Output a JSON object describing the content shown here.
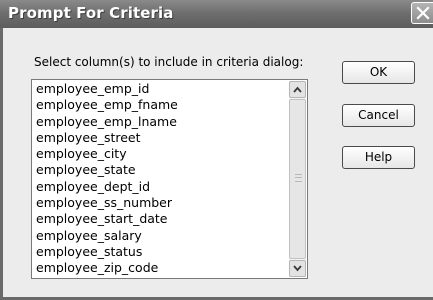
{
  "window": {
    "title": "Prompt For Criteria"
  },
  "dialog": {
    "instruction": "Select column(s) to include in criteria dialog:",
    "columns": [
      "employee_emp_id",
      "employee_emp_fname",
      "employee_emp_lname",
      "employee_street",
      "employee_city",
      "employee_state",
      "employee_dept_id",
      "employee_ss_number",
      "employee_start_date",
      "employee_salary",
      "employee_status",
      "employee_zip_code"
    ]
  },
  "buttons": {
    "ok": "OK",
    "cancel": "Cancel",
    "help": "Help"
  },
  "icons": {
    "close": "close-icon",
    "scroll_up": "scroll-up-arrow-icon",
    "scroll_down": "scroll-down-arrow-icon"
  }
}
